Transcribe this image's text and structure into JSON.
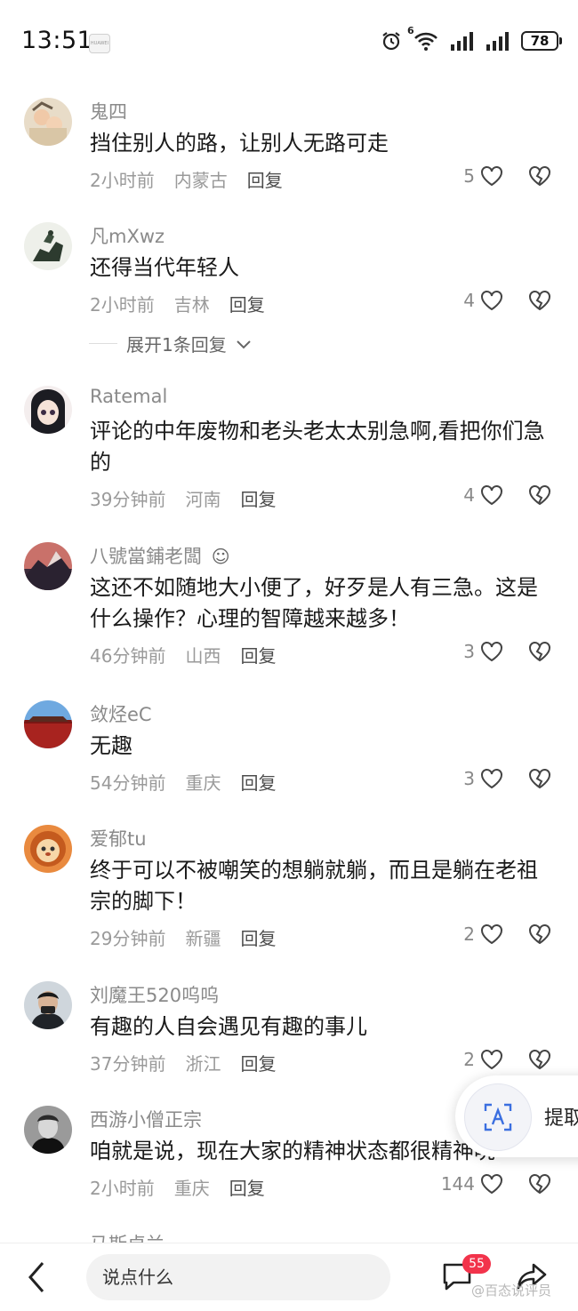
{
  "status_bar": {
    "time": "13:51",
    "brand": "HUAWEI",
    "battery": "78",
    "signal_label": "6"
  },
  "comments": [
    {
      "username": "鬼四",
      "text": "挡住别人的路，让别人无路可走",
      "time": "2小时前",
      "location": "内蒙古",
      "reply": "回复",
      "likes": "5"
    },
    {
      "username": "凡mXwz",
      "text": "还得当代年轻人",
      "time": "2小时前",
      "location": "吉林",
      "reply": "回复",
      "likes": "4"
    },
    {
      "username": "Ratemal",
      "text": "评论的中年废物和老头老太太别急啊,看把你们急的",
      "time": "39分钟前",
      "location": "河南",
      "reply": "回复",
      "likes": "4"
    },
    {
      "username": "八號當鋪老闆",
      "text": "这还不如随地大小便了，好歹是人有三急。这是什么操作？心理的智障越来越多！",
      "time": "46分钟前",
      "location": "山西",
      "reply": "回复",
      "likes": "3"
    },
    {
      "username": "敛烃eC",
      "text": "无趣",
      "time": "54分钟前",
      "location": "重庆",
      "reply": "回复",
      "likes": "3"
    },
    {
      "username": "爱郁tu",
      "text": "终于可以不被嘲笑的想躺就躺，而且是躺在老祖宗的脚下！",
      "time": "29分钟前",
      "location": "新疆",
      "reply": "回复",
      "likes": "2"
    },
    {
      "username": "刘魔王520呜呜",
      "text": "有趣的人自会遇见有趣的事儿",
      "time": "37分钟前",
      "location": "浙江",
      "reply": "回复",
      "likes": "2"
    },
    {
      "username": "西游小僧正宗",
      "text": "咱就是说，现在大家的精神状态都很精神吮",
      "time": "2小时前",
      "location": "重庆",
      "reply": "回复",
      "likes": "144"
    }
  ],
  "expand_replies": "展开1条回复",
  "partial_next_username": "马斯卓兰",
  "float_extract": {
    "label": "提取"
  },
  "bottom_bar": {
    "input_placeholder": "说点什么",
    "comment_badge": "55",
    "watermark": "@百态说评员"
  },
  "icons": {
    "like": "heart-outline-icon",
    "dislike": "broken-heart-icon",
    "back": "chevron-left-icon",
    "comment": "chat-bubble-icon",
    "share": "share-arrow-icon"
  }
}
